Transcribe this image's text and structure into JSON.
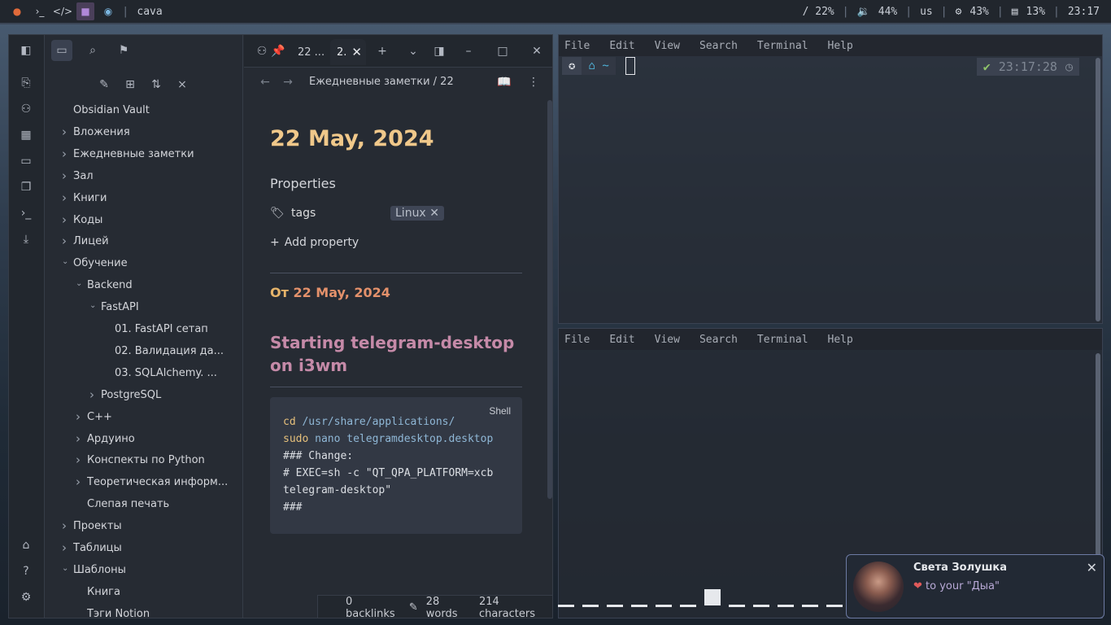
{
  "topbar": {
    "window_title": "cava",
    "disk": "/ 22%",
    "volume": "44%",
    "layout": "us",
    "cpu": "43%",
    "mem": "13%",
    "time": "23:17"
  },
  "obsidian": {
    "vault_name": "Obsidian Vault",
    "tree": [
      {
        "label": "Вложения",
        "level": 0,
        "chevron": "right"
      },
      {
        "label": "Ежедневные заметки",
        "level": 0,
        "chevron": "right"
      },
      {
        "label": "Зал",
        "level": 0,
        "chevron": "right"
      },
      {
        "label": "Книги",
        "level": 0,
        "chevron": "right"
      },
      {
        "label": "Коды",
        "level": 0,
        "chevron": "right"
      },
      {
        "label": "Лицей",
        "level": 0,
        "chevron": "right"
      },
      {
        "label": "Обучение",
        "level": 0,
        "chevron": "down"
      },
      {
        "label": "Backend",
        "level": 1,
        "chevron": "down"
      },
      {
        "label": "FastAPI",
        "level": 2,
        "chevron": "down"
      },
      {
        "label": "01. FastAPI сетап",
        "level": 3,
        "chevron": ""
      },
      {
        "label": "02. Валидация да...",
        "level": 3,
        "chevron": ""
      },
      {
        "label": "03. SQLAlchemy. ...",
        "level": 3,
        "chevron": ""
      },
      {
        "label": "PostgreSQL",
        "level": 2,
        "chevron": "right"
      },
      {
        "label": "C++",
        "level": 1,
        "chevron": "right"
      },
      {
        "label": "Ардуино",
        "level": 1,
        "chevron": "right"
      },
      {
        "label": "Конспекты по Python",
        "level": 1,
        "chevron": "right"
      },
      {
        "label": "Теоретическая информ...",
        "level": 1,
        "chevron": "right"
      },
      {
        "label": "Слепая печать",
        "level": 1,
        "chevron": ""
      },
      {
        "label": "Проекты",
        "level": 0,
        "chevron": "right"
      },
      {
        "label": "Таблицы",
        "level": 0,
        "chevron": "right"
      },
      {
        "label": "Шаблоны",
        "level": 0,
        "chevron": "down"
      },
      {
        "label": "Книга",
        "level": 1,
        "chevron": ""
      },
      {
        "label": "Тэги Notion",
        "level": 1,
        "chevron": ""
      }
    ],
    "tabs": {
      "tab1": "22 ...",
      "tab2": "2."
    },
    "breadcrumb": "Ежедневные заметки / 22 М",
    "note": {
      "title": "22 May, 2024",
      "properties_label": "Properties",
      "tags_label": "tags",
      "tag_value": "Linux",
      "add_property": "Add property",
      "from_prefix": "От",
      "from_link": "22 May, 2024",
      "heading": "Starting telegram-desktop on i3wm",
      "code_lang": "Shell",
      "code": [
        {
          "a": "cd",
          "b": " /usr/share/applications/"
        },
        {
          "a": "sudo",
          "b": " nano telegramdesktop.desktop"
        },
        {
          "a": "",
          "b": "### Change:"
        },
        {
          "a": "",
          "b": "# EXEC=sh -c \"QT_QPA_PLATFORM=xcb"
        },
        {
          "a": "",
          "b": "telegram-desktop\""
        },
        {
          "a": "",
          "b": "###"
        }
      ]
    },
    "status": {
      "backlinks": "0 backlinks",
      "words": "28 words",
      "characters": "214 characters"
    }
  },
  "terminal": {
    "menu": [
      "File",
      "Edit",
      "View",
      "Search",
      "Terminal",
      "Help"
    ],
    "prompt_home": "~",
    "clock": "23:17:28"
  },
  "notification": {
    "sender": "Света Золушка",
    "message": "to your \"Дыа\""
  },
  "colors": {
    "title": "#f0c88a",
    "heading": "#c58aa8",
    "link": "#e4916b"
  }
}
